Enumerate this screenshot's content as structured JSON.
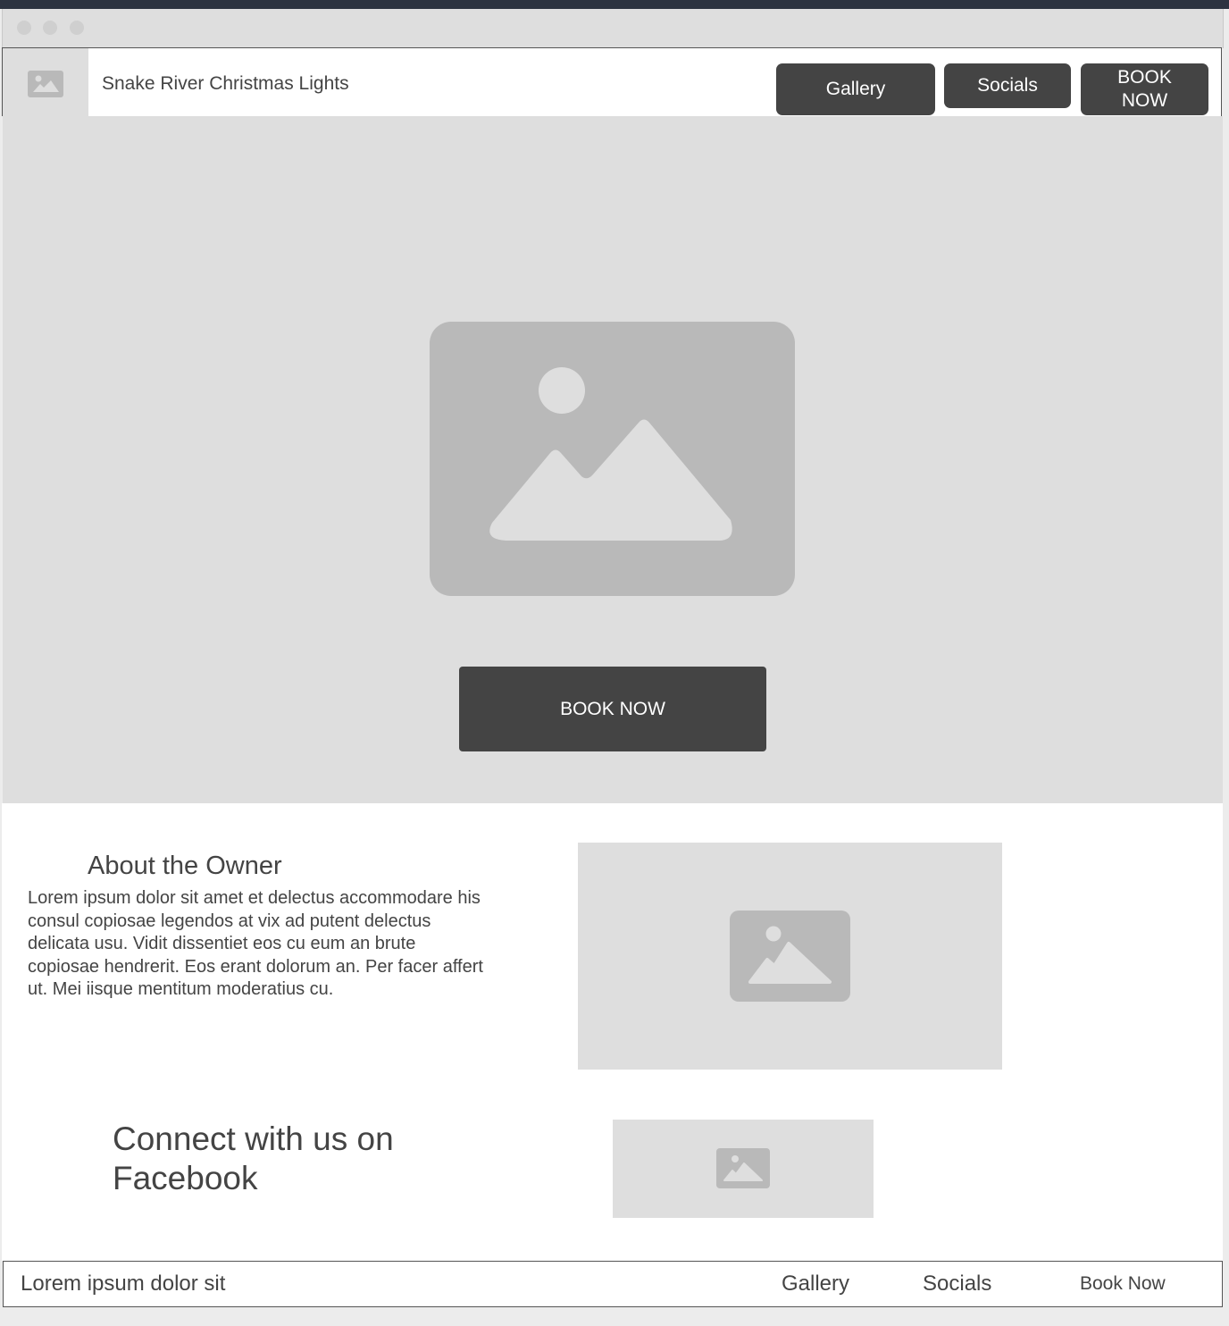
{
  "header": {
    "site_title": "Snake River Christmas Lights",
    "nav": {
      "gallery": "Gallery",
      "socials": "Socials",
      "book_now": "BOOK NOW"
    }
  },
  "hero": {
    "cta_label": "BOOK NOW"
  },
  "about": {
    "title": "About the Owner",
    "body": "Lorem ipsum dolor sit amet et delectus accommodare his consul copiosae legendos at vix ad putent delectus delicata usu. Vidit dissentiet eos cu eum an brute copiosae hendrerit. Eos erant dolorum an. Per facer affert ut. Mei iisque mentitum moderatius cu."
  },
  "connect": {
    "title": "Connect with us on Facebook"
  },
  "footer": {
    "text": "Lorem ipsum dolor sit",
    "links": {
      "gallery": "Gallery",
      "socials": "Socials",
      "book_now": "Book Now"
    }
  },
  "icons": {
    "logo": "image-placeholder-icon",
    "hero": "image-placeholder-icon",
    "about": "image-placeholder-icon",
    "connect": "image-placeholder-icon"
  },
  "colors": {
    "button": "#444444",
    "placeholder_bg": "#dedede",
    "placeholder_icon": "#b9b9b9",
    "text": "#444444"
  }
}
